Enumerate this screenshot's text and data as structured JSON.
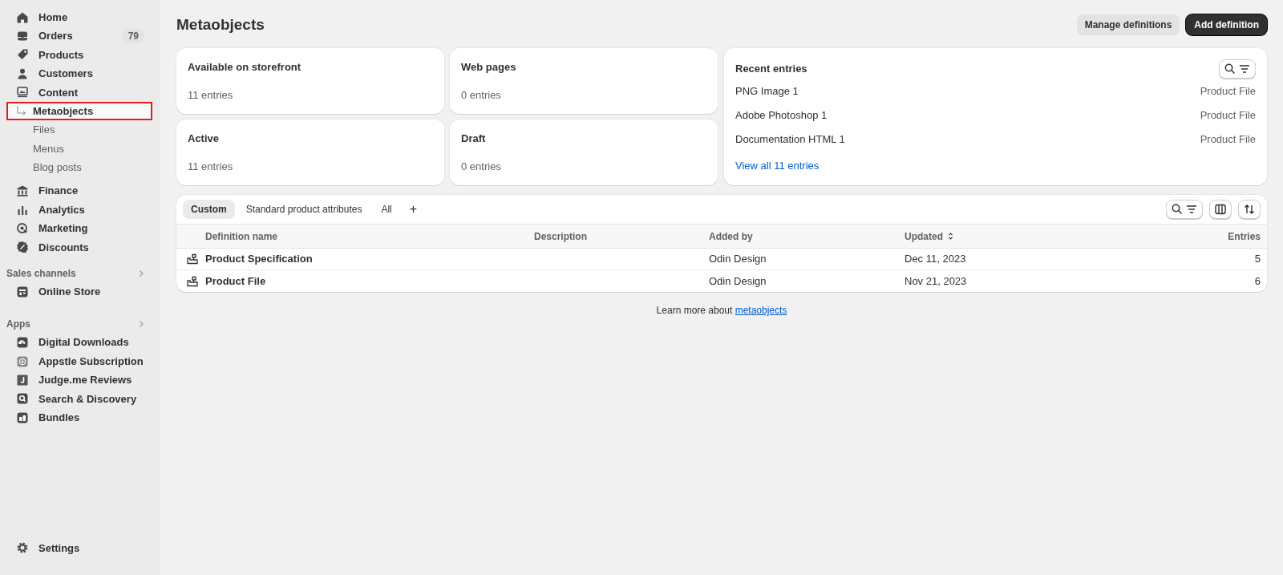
{
  "sidebar": {
    "items": [
      {
        "label": "Home",
        "selected": false
      },
      {
        "label": "Orders",
        "badge": "79",
        "selected": false
      },
      {
        "label": "Products",
        "selected": false
      },
      {
        "label": "Customers",
        "selected": false
      },
      {
        "label": "Content",
        "selected": false,
        "children": [
          {
            "label": "Metaobjects",
            "selected": true
          },
          {
            "label": "Files",
            "selected": false
          },
          {
            "label": "Menus",
            "selected": false
          },
          {
            "label": "Blog posts",
            "selected": false
          }
        ]
      },
      {
        "label": "Finance",
        "selected": false
      },
      {
        "label": "Analytics",
        "selected": false
      },
      {
        "label": "Marketing",
        "selected": false
      },
      {
        "label": "Discounts",
        "selected": false
      }
    ],
    "sections": [
      {
        "title": "Sales channels",
        "items": [
          {
            "label": "Online Store",
            "selected": false
          }
        ]
      },
      {
        "title": "Apps",
        "items": [
          {
            "label": "Digital Downloads",
            "selected": false
          },
          {
            "label": "Appstle Subscription",
            "selected": false
          },
          {
            "label": "Judge.me Reviews",
            "selected": false
          },
          {
            "label": "Search & Discovery",
            "selected": false
          },
          {
            "label": "Bundles",
            "selected": false
          }
        ]
      }
    ],
    "settings": "Settings"
  },
  "page": {
    "title": "Metaobjects",
    "buttons": [
      {
        "label": "Manage definitions",
        "kind": "secondary"
      },
      {
        "label": "Add definition",
        "kind": "primary"
      }
    ]
  },
  "stats": [
    {
      "title": "Available on storefront",
      "value": "11 entries"
    },
    {
      "title": "Web pages",
      "value": "0 entries"
    },
    {
      "title": "Active",
      "value": "11 entries"
    },
    {
      "title": "Draft",
      "value": "0 entries"
    }
  ],
  "recent_entries": {
    "title": "Recent entries",
    "rows": [
      {
        "name": "PNG Image 1",
        "type": "Product File"
      },
      {
        "name": "Adobe Photoshop 1",
        "type": "Product File"
      },
      {
        "name": "Documentation HTML 1",
        "type": "Product File"
      }
    ],
    "link": "View all 11 entries"
  },
  "table": {
    "tabs": [
      {
        "label": "Custom",
        "selected": true
      },
      {
        "label": "Standard product attributes",
        "selected": false
      },
      {
        "label": "All",
        "selected": false
      }
    ],
    "add_tab": "+",
    "columns": [
      "Definition name",
      "Description",
      "Added by",
      "Updated",
      "Entries"
    ],
    "rows": [
      {
        "name": "Product Specification",
        "description": "",
        "added_by": "Odin Design",
        "updated": "Dec 11, 2023",
        "entries": "5"
      },
      {
        "name": "Product File",
        "description": "",
        "added_by": "Odin Design",
        "updated": "Nov 21, 2023",
        "entries": "6"
      }
    ]
  },
  "footer": {
    "text": "Learn more about ",
    "link": "metaobjects"
  }
}
